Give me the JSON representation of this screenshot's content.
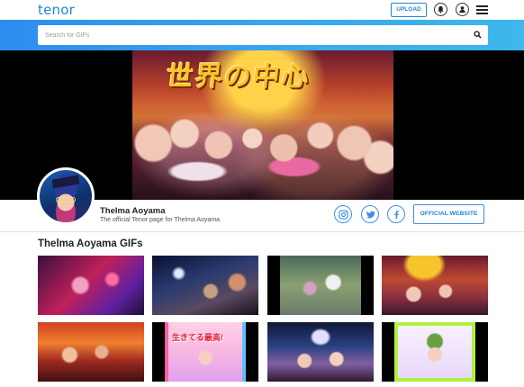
{
  "header": {
    "logo": "tenor",
    "upload_label": "UPLOAD"
  },
  "search": {
    "placeholder": "Search for GIFs"
  },
  "hero": {
    "overlay_text": "世界の中心"
  },
  "profile": {
    "name": "Thelma Aoyama",
    "description": "The official Tenor page for Thelma Aoyama",
    "website_label": "OFFICIAL WEBSITE"
  },
  "gifs": {
    "section_title": "Thelma Aoyama GIFs",
    "tile6_text": "生きてる最高!"
  },
  "colors": {
    "accent": "#1e88d8",
    "search_band": "#36a6ee"
  },
  "icons": [
    "bell-icon",
    "user-icon",
    "menu-icon",
    "search-icon",
    "instagram-icon",
    "twitter-icon",
    "facebook-icon"
  ]
}
